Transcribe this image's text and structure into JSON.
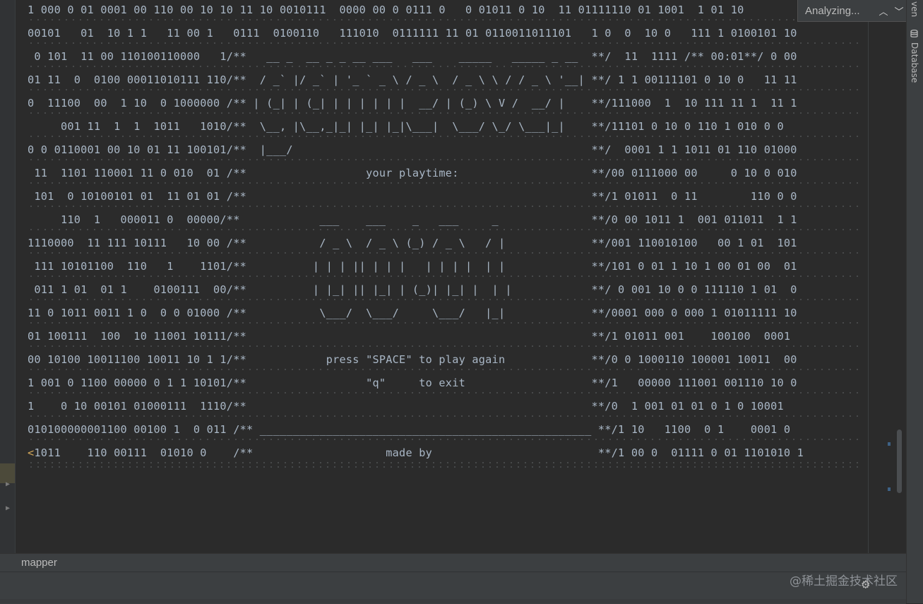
{
  "editor": {
    "lines": [
      "1 000 0 01 0001 00 110 00 10 10 11 10 0010111  0000 00 0 0111 0   0 01011 0 10  11 01111110 01 1001  1 01 10",
      "00101   01  10 1 1   11 00 1   0111  0100110   111010  0111111 11 01 0110011011101   1 0  0  10 0   111 1 0100101 10",
      " 0 101  11 00 110100110000   1/**   __ _  __ _ _ __ ___   ___    _____   _____ _ __  **/  11  1111 /** 00:01**/ 0 00",
      "01 11  0  0100 00011010111 110/**  / _` |/ _` | '_ ` _ \\ / _ \\  / _ \\ \\ / / _ \\ '__| **/ 1 1 00111101 0 10 0   11 11",
      "0  11100  00  1 10  0 1000000 /** | (_| | (_| | | | | | |  __/ | (_) \\ V /  __/ |    **/111000  1  10 111 11 1  11 1",
      "     001 11  1  1  1011   1010/**  \\__, |\\__,_|_| |_| |_|\\___|  \\___/ \\_/ \\___|_|    **/11101 0 10 0 110 1 010 0 0",
      "0 0 0110001 00 10 01 11 100101/**  |___/                                             **/  0001 1 1 1011 01 110 01000",
      " 11  1101 110001 11 0 010  01 /**                  your playtime:                    **/00 0111000 00     0 10 0 010",
      " 101  0 10100101 01  11 01 01 /**                                                    **/1 01011  0 11        110 0 0",
      "     110  1   000011 0  00000/**            ___    ___    _   ___     _              **/0 00 1011 1  001 011011  1 1",
      "1110000  11 111 10111   10 00 /**           / _ \\  / _ \\ (_) / _ \\   / |             **/001 110010100   00 1 01  101",
      " 111 10101100  110   1    1101/**          | | | || | | |   | | | |  | |             **/101 0 01 1 10 1 00 01 00  01",
      " 011 1 01  01 1    0100111  00/**          | |_| || |_| | (_)| |_| |  | |            **/ 0 001 10 0 0 111110 1 01  0",
      "11 0 1011 0011 1 0  0 0 01000 /**           \\___/  \\___/     \\___/   |_|             **/0001 000 0 000 1 01011111 10",
      "01 100111  100  10 11001 10111/**                                                    **/1 01011 001    100100  0001",
      "00 10100 10011100 10011 10 1 1/**            press \"SPACE\" to play again             **/0 0 1000110 100001 10011  00",
      "1 001 0 1100 00000 0 1 1 10101/**                  \"q\"     to exit                   **/1   00000 111001 001110 10 0",
      "1    0 10 00101 01000111  1110/**                                                    **/0  1 001 01 01 0 1 0 10001",
      "010100000001100 00100 1  0 011 /** __________________________________________________ **/1 10   1100  0 1    0001 0",
      "<1011    110 00111  01010 0    /**                    made by                         **/1 00 0  01111 0 01 1101010 1"
    ]
  },
  "analyzing": {
    "label": "Analyzing...",
    "up_icon": "chevron-up-icon",
    "down_icon": "chevron-down-icon"
  },
  "sidebar": {
    "top_tab": "ven",
    "database_label": "Database"
  },
  "breadcrumb": {
    "text": "mapper"
  },
  "watermark": {
    "text": "@稀土掘金技术社区"
  },
  "colors": {
    "editor_bg": "#2b2b2b",
    "code_text": "#a9b7c6",
    "panel_bg": "#3c3f41"
  }
}
